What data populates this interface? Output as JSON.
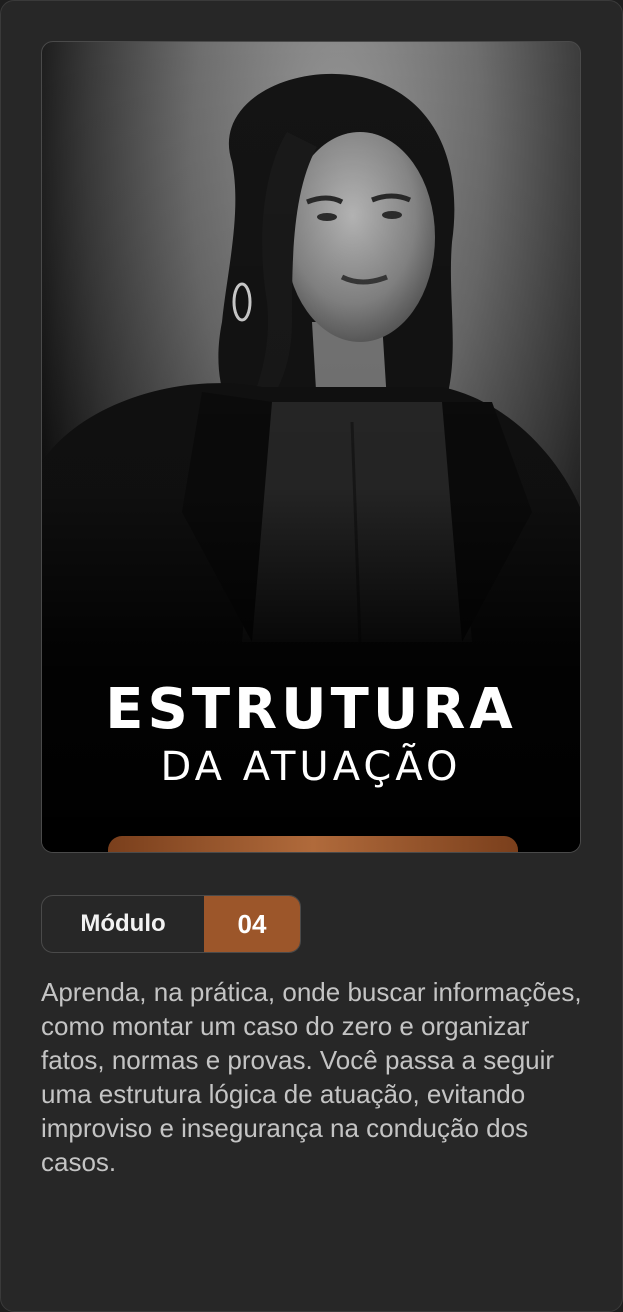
{
  "cover": {
    "title_main": "ESTRUTURA",
    "title_sub": "DA ATUAÇÃO",
    "accent_color": "#9c562a"
  },
  "module": {
    "label": "Módulo",
    "number": "04"
  },
  "description": "Aprenda, na prática, onde buscar informações, como montar um caso do zero e organizar fatos, normas e provas. Você passa a seguir uma estrutura lógica de atuação, evitando improviso e insegurança na condução dos casos."
}
